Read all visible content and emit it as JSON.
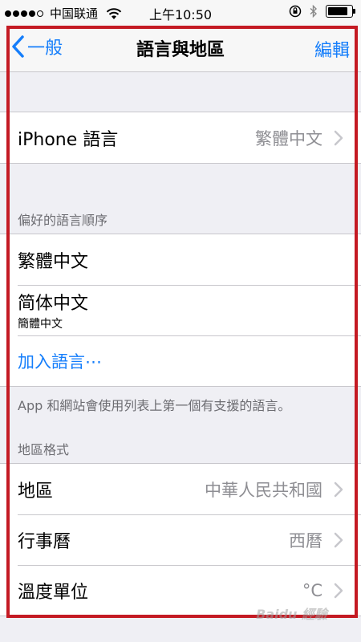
{
  "status_bar": {
    "carrier": "中国联通",
    "time": "上午10:50",
    "signal_bars_filled": 4,
    "signal_bars_total": 5,
    "battery_level": 0.85
  },
  "nav": {
    "back_label": "一般",
    "title": "語言與地區",
    "edit_label": "編輯"
  },
  "iphone_language": {
    "label": "iPhone 語言",
    "value": "繁體中文"
  },
  "preferred_languages": {
    "header": "偏好的語言順序",
    "items": [
      {
        "label": "繁體中文",
        "sub": ""
      },
      {
        "label": "简体中文",
        "sub": "簡體中文"
      }
    ],
    "add_label": "加入語言⋯",
    "footer": "App 和網站會使用列表上第一個有支援的語言。"
  },
  "region_format": {
    "header": "地區格式",
    "rows": [
      {
        "label": "地區",
        "value": "中華人民共和國"
      },
      {
        "label": "行事曆",
        "value": "西曆"
      },
      {
        "label": "溫度單位",
        "value": "°C"
      }
    ]
  },
  "colors": {
    "accent": "#157efb",
    "annotation": "#c41a23",
    "background": "#efeff4"
  },
  "watermark": "Baidu 經驗"
}
